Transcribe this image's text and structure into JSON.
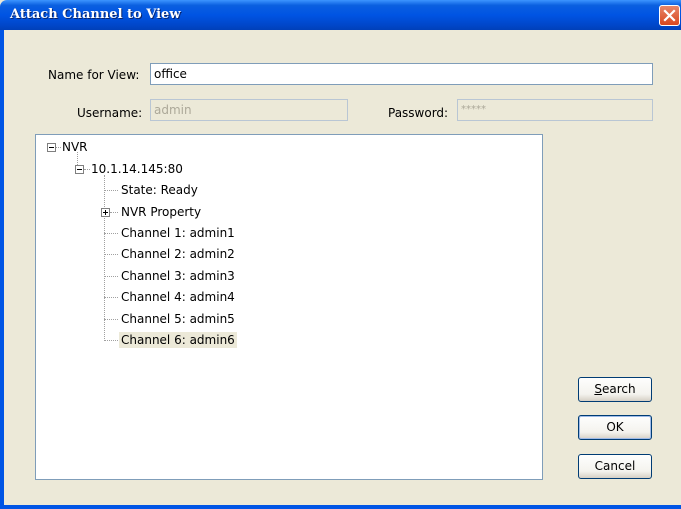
{
  "window": {
    "title": "Attach Channel to View",
    "close_glyph": "×"
  },
  "form": {
    "name_label": "Name for View:",
    "name_value": "office",
    "username_label": "Username:",
    "username_value": "admin",
    "password_label": "Password:",
    "password_value": "*****"
  },
  "tree": {
    "root": {
      "label": "NVR",
      "expanded": true
    },
    "server": {
      "label": "10.1.14.145:80",
      "expanded": true
    },
    "items": [
      {
        "label": "State: Ready",
        "expandable": false
      },
      {
        "label": "NVR Property",
        "expandable": true
      },
      {
        "label": "Channel 1: admin1",
        "expandable": false
      },
      {
        "label": "Channel 2: admin2",
        "expandable": false
      },
      {
        "label": "Channel 3: admin3",
        "expandable": false
      },
      {
        "label": "Channel 4: admin4",
        "expandable": false
      },
      {
        "label": "Channel 5: admin5",
        "expandable": false
      },
      {
        "label": "Channel 6: admin6",
        "expandable": false,
        "selected": true
      }
    ]
  },
  "buttons": {
    "search_accel": "S",
    "search_rest": "earch",
    "ok": "OK",
    "cancel": "Cancel"
  },
  "colors": {
    "titlebar": "#0054e3",
    "dialog_bg": "#ece9d8",
    "close": "#d9471e"
  }
}
